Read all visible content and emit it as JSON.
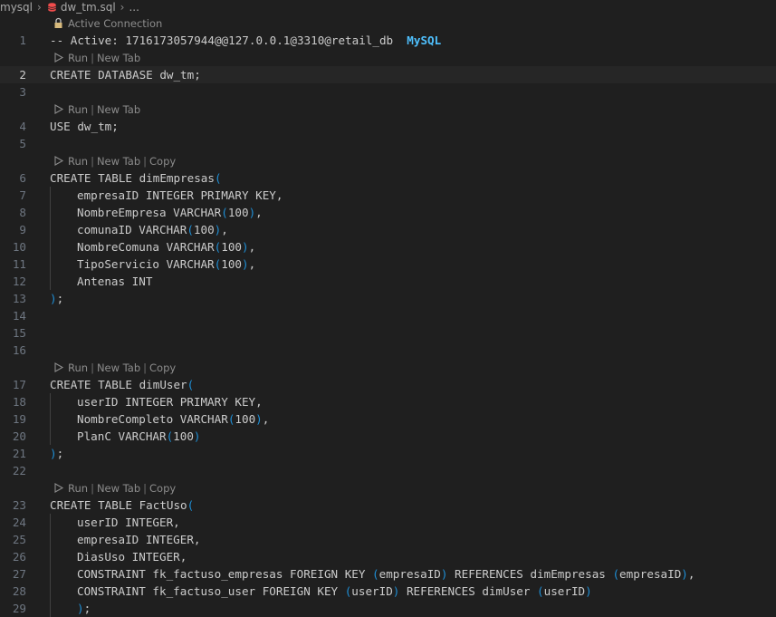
{
  "breadcrumb": {
    "root": "mysql",
    "file": "dw_tm.sql",
    "more": "..."
  },
  "colors": {
    "background": "#1f1f1f",
    "text": "#cccccc",
    "line_number": "#6e7681",
    "codelens": "#8c8c8c",
    "mysql_badge": "#4fc1ff",
    "bracket": "#1f8fd6",
    "db_icon": "#f14c4c"
  },
  "rows": [
    {
      "kind": "lens",
      "icon": "lock-icon",
      "items": [
        "Active Connection"
      ]
    },
    {
      "kind": "line",
      "num": "1",
      "text": "-- Active: 1716173057944@@127.0.0.1@3310@retail_db  ",
      "badge": "MySQL"
    },
    {
      "kind": "lens",
      "icon": "run-icon",
      "items": [
        "Run",
        "New Tab"
      ]
    },
    {
      "kind": "line",
      "num": "2",
      "text": "CREATE DATABASE dw_tm;",
      "current": true
    },
    {
      "kind": "line",
      "num": "3",
      "text": ""
    },
    {
      "kind": "lens",
      "icon": "run-icon",
      "items": [
        "Run",
        "New Tab"
      ]
    },
    {
      "kind": "line",
      "num": "4",
      "text": "USE dw_tm;"
    },
    {
      "kind": "line",
      "num": "5",
      "text": ""
    },
    {
      "kind": "lens",
      "icon": "run-icon",
      "items": [
        "Run",
        "New Tab",
        "Copy"
      ]
    },
    {
      "kind": "line",
      "num": "6",
      "text": "CREATE TABLE dimEmpresas("
    },
    {
      "kind": "line",
      "num": "7",
      "indent": 1,
      "text": "empresaID INTEGER PRIMARY KEY,"
    },
    {
      "kind": "line",
      "num": "8",
      "indent": 1,
      "text": "NombreEmpresa VARCHAR(100),"
    },
    {
      "kind": "line",
      "num": "9",
      "indent": 1,
      "text": "comunaID VARCHAR(100),"
    },
    {
      "kind": "line",
      "num": "10",
      "indent": 1,
      "text": "NombreComuna VARCHAR(100),"
    },
    {
      "kind": "line",
      "num": "11",
      "indent": 1,
      "text": "TipoServicio VARCHAR(100),"
    },
    {
      "kind": "line",
      "num": "12",
      "indent": 1,
      "text": "Antenas INT"
    },
    {
      "kind": "line",
      "num": "13",
      "text": ");"
    },
    {
      "kind": "line",
      "num": "14",
      "text": ""
    },
    {
      "kind": "line",
      "num": "15",
      "text": ""
    },
    {
      "kind": "line",
      "num": "16",
      "text": ""
    },
    {
      "kind": "lens",
      "icon": "run-icon",
      "items": [
        "Run",
        "New Tab",
        "Copy"
      ]
    },
    {
      "kind": "line",
      "num": "17",
      "text": "CREATE TABLE dimUser("
    },
    {
      "kind": "line",
      "num": "18",
      "indent": 1,
      "text": "userID INTEGER PRIMARY KEY,"
    },
    {
      "kind": "line",
      "num": "19",
      "indent": 1,
      "text": "NombreCompleto VARCHAR(100),"
    },
    {
      "kind": "line",
      "num": "20",
      "indent": 1,
      "text": "PlanC VARCHAR(100)"
    },
    {
      "kind": "line",
      "num": "21",
      "text": ");"
    },
    {
      "kind": "line",
      "num": "22",
      "text": ""
    },
    {
      "kind": "lens",
      "icon": "run-icon",
      "items": [
        "Run",
        "New Tab",
        "Copy"
      ]
    },
    {
      "kind": "line",
      "num": "23",
      "text": "CREATE TABLE FactUso("
    },
    {
      "kind": "line",
      "num": "24",
      "indent": 1,
      "text": "userID INTEGER,"
    },
    {
      "kind": "line",
      "num": "25",
      "indent": 1,
      "text": "empresaID INTEGER,"
    },
    {
      "kind": "line",
      "num": "26",
      "indent": 1,
      "text": "DiasUso INTEGER,"
    },
    {
      "kind": "line",
      "num": "27",
      "indent": 1,
      "text": "CONSTRAINT fk_factuso_empresas FOREIGN KEY (empresaID) REFERENCES dimEmpresas (empresaID),"
    },
    {
      "kind": "line",
      "num": "28",
      "indent": 1,
      "text": "CONSTRAINT fk_factuso_user FOREIGN KEY (userID) REFERENCES dimUser (userID)"
    },
    {
      "kind": "line",
      "num": "29",
      "indent": 1,
      "text": ");"
    }
  ]
}
